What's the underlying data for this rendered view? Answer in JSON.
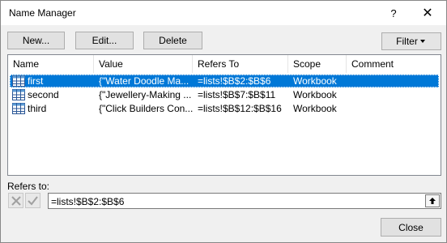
{
  "dialog": {
    "title": "Name Manager",
    "help_glyph": "?",
    "close_glyph": "✕"
  },
  "toolbar": {
    "new_label": "New...",
    "edit_label": "Edit...",
    "delete_label": "Delete",
    "filter_label": "Filter"
  },
  "list": {
    "columns": [
      "Name",
      "Value",
      "Refers To",
      "Scope",
      "Comment"
    ],
    "rows": [
      {
        "name": "first",
        "value": "{\"Water Doodle Ma...",
        "refers_to": "=lists!$B$2:$B$6",
        "scope": "Workbook",
        "comment": "",
        "selected": true
      },
      {
        "name": "second",
        "value": "{\"Jewellery-Making ...",
        "refers_to": "=lists!$B$7:$B$11",
        "scope": "Workbook",
        "comment": "",
        "selected": false
      },
      {
        "name": "third",
        "value": "{\"Click Builders Con...",
        "refers_to": "=lists!$B$12:$B$16",
        "scope": "Workbook",
        "comment": "",
        "selected": false
      }
    ]
  },
  "refers": {
    "label": "Refers to:",
    "value": "=lists!$B$2:$B$6"
  },
  "footer": {
    "close_label": "Close"
  },
  "colors": {
    "selection": "#0078d7",
    "button_face": "#e1e1e1",
    "dialog_bg": "#f0f0f0"
  }
}
